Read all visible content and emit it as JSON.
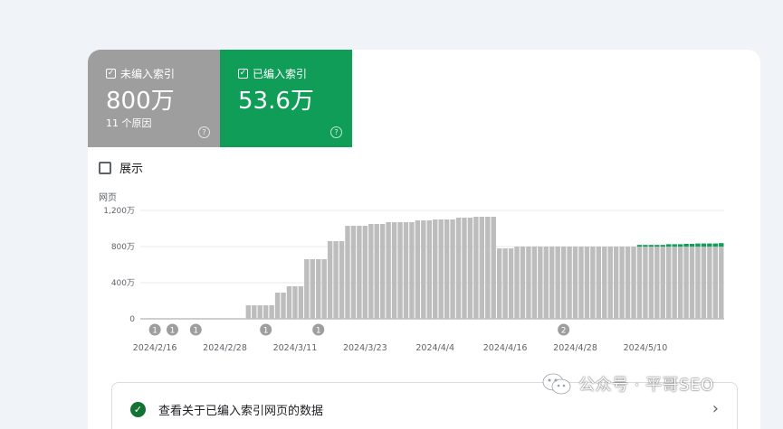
{
  "tiles": {
    "not_indexed": {
      "label": "未编入索引",
      "value": "800万",
      "sub": "11 个原因",
      "help": "?"
    },
    "indexed": {
      "label": "已编入索引",
      "value": "53.6万",
      "help": "?"
    }
  },
  "show_toggle": {
    "label": "展示"
  },
  "bottom_row": {
    "text": "查看关于已编入索引网页的数据",
    "check": "✓",
    "chevron": "›"
  },
  "watermark": {
    "text": "公众号 · 平哥SEO"
  },
  "colors": {
    "gray_bar": "#bdbdbd",
    "green_bar": "#0f9d58",
    "gray_tile": "#9e9e9e",
    "green_tile": "#0f9d58"
  },
  "chart_data": {
    "type": "bar",
    "ylabel": "网页",
    "ylim": [
      0,
      12000000
    ],
    "y_ticks": [
      {
        "value": 0,
        "label": "0"
      },
      {
        "value": 4000000,
        "label": "400万"
      },
      {
        "value": 8000000,
        "label": "800万"
      },
      {
        "value": 12000000,
        "label": "1,200万"
      }
    ],
    "x_tick_labels": [
      "2024/2/16",
      "2024/2/28",
      "2024/3/11",
      "2024/3/23",
      "2024/4/4",
      "2024/4/16",
      "2024/4/28",
      "2024/5/10"
    ],
    "x_tick_bar_index": [
      2,
      14,
      26,
      38,
      50,
      62,
      74,
      86
    ],
    "series": [
      {
        "name": "未编入索引",
        "values": [
          0,
          0,
          0,
          0,
          0,
          0,
          0,
          0,
          0,
          0,
          0,
          0,
          0,
          0,
          0,
          0,
          0,
          0,
          1500000,
          1500000,
          1500000,
          1500000,
          1500000,
          2900000,
          2900000,
          3600000,
          3600000,
          3600000,
          6600000,
          6600000,
          6600000,
          6600000,
          8600000,
          8600000,
          8600000,
          10300000,
          10300000,
          10300000,
          10300000,
          10500000,
          10500000,
          10500000,
          10700000,
          10700000,
          10700000,
          10700000,
          10700000,
          10900000,
          10900000,
          10900000,
          11000000,
          11000000,
          11000000,
          11000000,
          11200000,
          11200000,
          11200000,
          11300000,
          11300000,
          11300000,
          11300000,
          7800000,
          7800000,
          7800000,
          8000000,
          8000000,
          8000000,
          8000000,
          8000000,
          8000000,
          8000000,
          8000000,
          8000000,
          8000000,
          8000000,
          8000000,
          8000000,
          8000000,
          8000000,
          8000000,
          8000000,
          8000000,
          8000000,
          8000000,
          8000000,
          8000000,
          8000000,
          8000000,
          8000000,
          8000000,
          8000000,
          8000000,
          8000000,
          8000000,
          8000000,
          8000000,
          8000000,
          8000000,
          8000000,
          8000000
        ]
      },
      {
        "name": "已编入索引",
        "values": [
          0,
          0,
          0,
          0,
          0,
          0,
          0,
          0,
          0,
          0,
          0,
          0,
          0,
          0,
          0,
          0,
          0,
          0,
          0,
          0,
          0,
          0,
          0,
          0,
          0,
          0,
          0,
          0,
          0,
          0,
          0,
          0,
          0,
          0,
          0,
          0,
          0,
          0,
          0,
          0,
          0,
          0,
          0,
          0,
          0,
          0,
          0,
          0,
          0,
          0,
          0,
          0,
          0,
          0,
          0,
          0,
          0,
          0,
          0,
          0,
          0,
          0,
          0,
          0,
          0,
          0,
          0,
          0,
          0,
          0,
          0,
          0,
          0,
          0,
          0,
          0,
          0,
          0,
          0,
          0,
          0,
          0,
          0,
          0,
          0,
          180000,
          180000,
          180000,
          180000,
          180000,
          260000,
          260000,
          260000,
          300000,
          300000,
          340000,
          340000,
          340000,
          340000,
          380000,
          380000,
          380000,
          380000,
          400000,
          400000,
          400000,
          450000,
          450000
        ]
      }
    ],
    "annotations": [
      {
        "label": "1",
        "bar_index": 2
      },
      {
        "label": "1",
        "bar_index": 5
      },
      {
        "label": "1",
        "bar_index": 9
      },
      {
        "label": "1",
        "bar_index": 21
      },
      {
        "label": "1",
        "bar_index": 30
      },
      {
        "label": "2",
        "bar_index": 72
      }
    ],
    "grid": true
  }
}
